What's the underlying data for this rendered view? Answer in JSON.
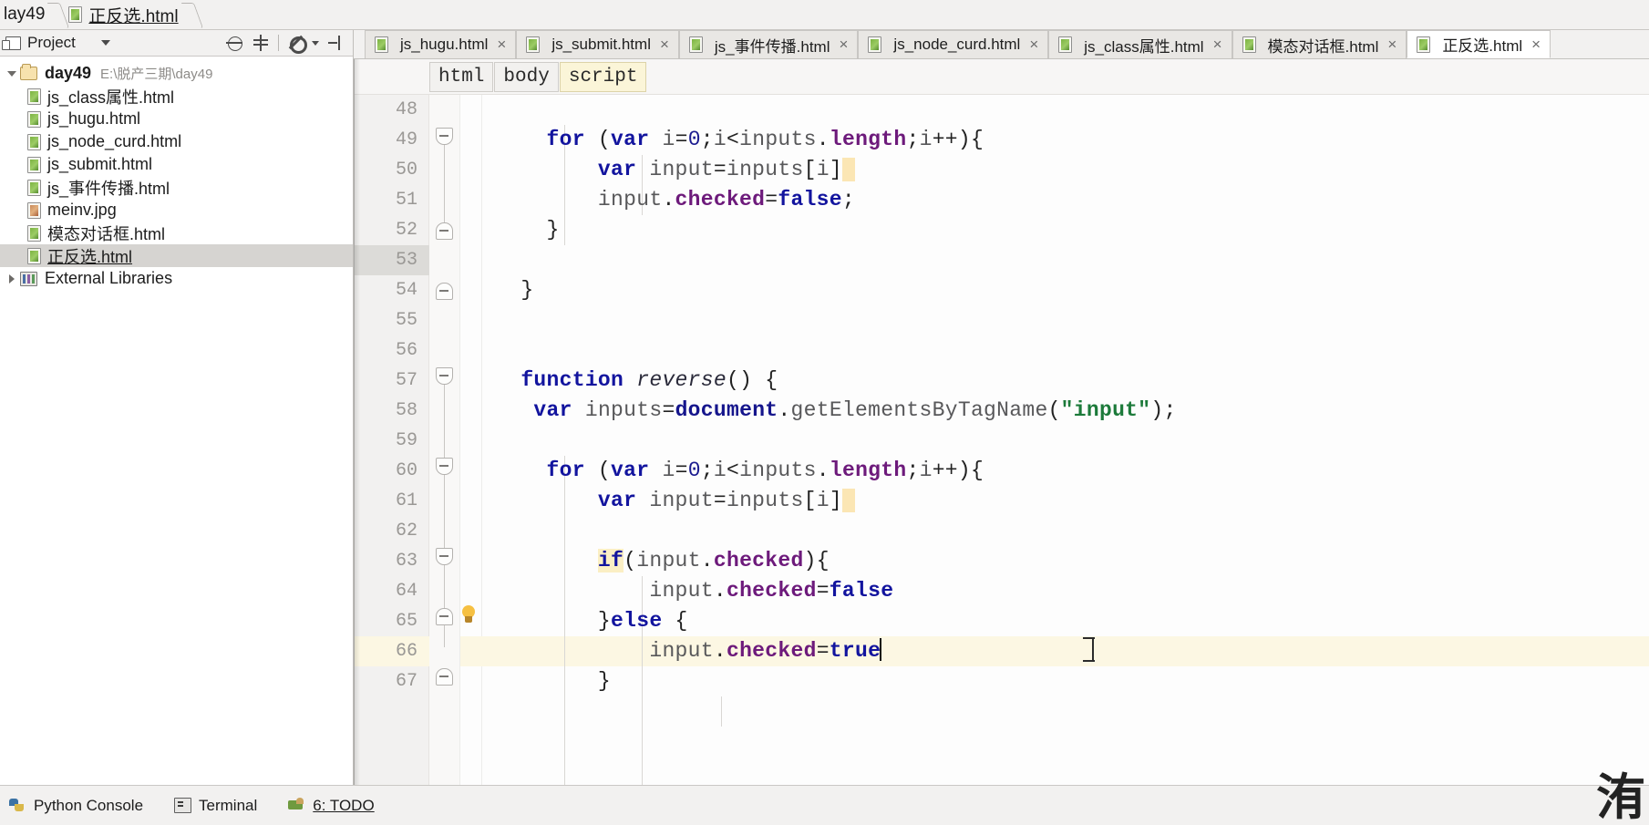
{
  "breadcrumb": {
    "project": "lay49",
    "file": "正反选.html",
    "file_icon": "html-file-icon"
  },
  "project_panel": {
    "title": "Project",
    "toolbar": [
      {
        "name": "locate-icon",
        "label": "⊕"
      },
      {
        "name": "collapse-all-icon",
        "label": "⊣"
      },
      {
        "name": "settings-gear-icon",
        "label": "⚙"
      },
      {
        "name": "hide-panel-icon",
        "label": "⇤"
      }
    ],
    "tree": [
      {
        "label": "day49",
        "path": "E:\\脱产三期\\day49",
        "icon": "folder-icon",
        "bold": true,
        "level": 0,
        "expanded": true,
        "selected": false
      },
      {
        "label": "js_class属性.html",
        "path": "",
        "icon": "html-file-icon",
        "bold": false,
        "level": 1,
        "selected": false
      },
      {
        "label": "js_hugu.html",
        "path": "",
        "icon": "html-file-icon",
        "bold": false,
        "level": 1,
        "selected": false
      },
      {
        "label": "js_node_curd.html",
        "path": "",
        "icon": "html-file-icon",
        "bold": false,
        "level": 1,
        "selected": false
      },
      {
        "label": "js_submit.html",
        "path": "",
        "icon": "html-file-icon",
        "bold": false,
        "level": 1,
        "selected": false
      },
      {
        "label": "js_事件传播.html",
        "path": "",
        "icon": "html-file-icon",
        "bold": false,
        "level": 1,
        "selected": false
      },
      {
        "label": "meinv.jpg",
        "path": "",
        "icon": "image-file-icon",
        "bold": false,
        "level": 1,
        "selected": false
      },
      {
        "label": "模态对话框.html",
        "path": "",
        "icon": "html-file-icon",
        "bold": false,
        "level": 1,
        "selected": false
      },
      {
        "label": "正反选.html",
        "path": "",
        "icon": "html-file-icon",
        "bold": false,
        "level": 1,
        "selected": true
      },
      {
        "label": "External Libraries",
        "path": "",
        "icon": "library-icon",
        "bold": false,
        "level": 0,
        "expanded": false,
        "selected": false
      }
    ]
  },
  "editor_tabs": [
    {
      "label": "js_hugu.html",
      "active": false,
      "close": "×"
    },
    {
      "label": "js_submit.html",
      "active": false,
      "close": "×"
    },
    {
      "label": "js_事件传播.html",
      "active": false,
      "close": "×"
    },
    {
      "label": "js_node_curd.html",
      "active": false,
      "close": "×"
    },
    {
      "label": "js_class属性.html",
      "active": false,
      "close": "×"
    },
    {
      "label": "模态对话框.html",
      "active": false,
      "close": "×"
    },
    {
      "label": "正反选.html",
      "active": true,
      "close": "×"
    }
  ],
  "structure_breadcrumbs": [
    {
      "label": "html",
      "highlight": false
    },
    {
      "label": "body",
      "highlight": false
    },
    {
      "label": "script",
      "highlight": true
    }
  ],
  "editor": {
    "first_line": 48,
    "current_line": 66,
    "selected_gutter_line": 53,
    "lines": [
      {
        "n": 48,
        "text": ""
      },
      {
        "n": 49,
        "text": "        for (var i=0;i<inputs.length;i++){"
      },
      {
        "n": 50,
        "text": "            var input=inputs[i]"
      },
      {
        "n": 51,
        "text": "            input.checked=false;"
      },
      {
        "n": 52,
        "text": "        }"
      },
      {
        "n": 53,
        "text": ""
      },
      {
        "n": 54,
        "text": "    }"
      },
      {
        "n": 55,
        "text": ""
      },
      {
        "n": 56,
        "text": ""
      },
      {
        "n": 57,
        "text": "    function reverse() {"
      },
      {
        "n": 58,
        "text": "        var inputs=document.getElementsByTagName(\"input\");"
      },
      {
        "n": 59,
        "text": ""
      },
      {
        "n": 60,
        "text": "        for (var i=0;i<inputs.length;i++){"
      },
      {
        "n": 61,
        "text": "            var input=inputs[i]"
      },
      {
        "n": 62,
        "text": ""
      },
      {
        "n": 63,
        "text": "            if(input.checked){"
      },
      {
        "n": 64,
        "text": "                input.checked=false"
      },
      {
        "n": 65,
        "text": "            }else {"
      },
      {
        "n": 66,
        "text": "                input.checked=true"
      },
      {
        "n": 67,
        "text": "            }"
      }
    ],
    "intention_bulb": "lightbulb-icon"
  },
  "statusbar": {
    "items": [
      {
        "label": "Python Console",
        "icon": "python-console-icon"
      },
      {
        "label": "Terminal",
        "icon": "terminal-icon"
      },
      {
        "label": "6: TODO",
        "icon": "todo-icon"
      }
    ]
  },
  "watermark": {
    "text": "洧"
  },
  "colors": {
    "keyword": "#12149e",
    "string": "#1c7a3a",
    "property": "#6d1a7b",
    "current_line_bg": "#fcf7e3",
    "selection_bg": "#dcdbd8",
    "token_highlight": "#fbe6b4",
    "panel_bg": "#f2f1f0",
    "editor_bg": "#fdfdfd"
  }
}
